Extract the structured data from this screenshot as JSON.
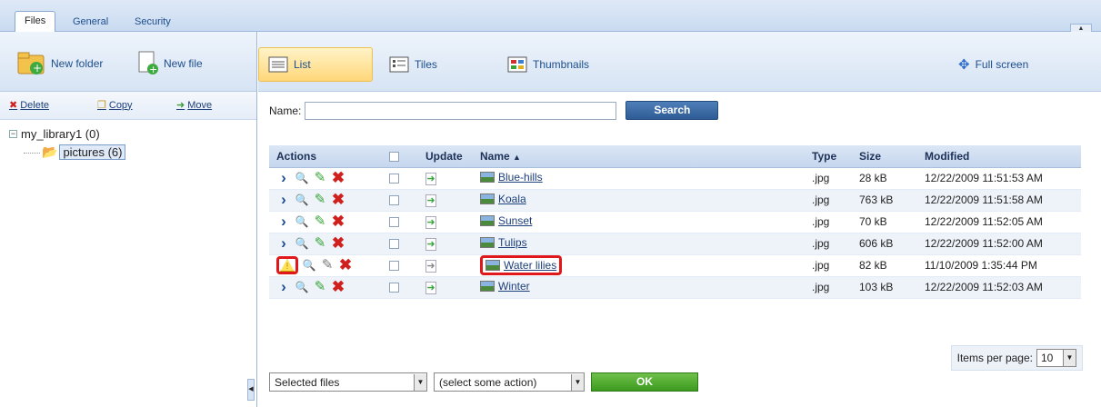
{
  "tabs": [
    "Files",
    "General",
    "Security"
  ],
  "left_toolbar": {
    "new_folder": "New folder",
    "new_file": "New file"
  },
  "left_actions": {
    "delete": "Delete",
    "copy": "Copy",
    "move": "Move"
  },
  "tree": {
    "root": "my_library1 (0)",
    "child": "pictures (6)"
  },
  "view_buttons": {
    "list": "List",
    "tiles": "Tiles",
    "thumbnails": "Thumbnails",
    "fullscreen": "Full screen"
  },
  "filter": {
    "label": "Name:",
    "value": "",
    "search": "Search"
  },
  "table": {
    "headers": {
      "actions": "Actions",
      "update": "Update",
      "name": "Name",
      "type": "Type",
      "size": "Size",
      "modified": "Modified"
    },
    "rows": [
      {
        "name": "Blue-hills",
        "type": ".jpg",
        "size": "28 kB",
        "modified": "12/22/2009 11:51:53 AM"
      },
      {
        "name": "Koala",
        "type": ".jpg",
        "size": "763 kB",
        "modified": "12/22/2009 11:51:58 AM"
      },
      {
        "name": "Sunset",
        "type": ".jpg",
        "size": "70 kB",
        "modified": "12/22/2009 11:52:05 AM"
      },
      {
        "name": "Tulips",
        "type": ".jpg",
        "size": "606 kB",
        "modified": "12/22/2009 11:52:00 AM"
      },
      {
        "name": "Water lilies",
        "type": ".jpg",
        "size": "82 kB",
        "modified": "11/10/2009 1:35:44 PM"
      },
      {
        "name": "Winter",
        "type": ".jpg",
        "size": "103 kB",
        "modified": "12/22/2009 11:52:03 AM"
      }
    ]
  },
  "pager": {
    "label": "Items per page:",
    "value": "10"
  },
  "bulk": {
    "selection": "Selected files",
    "action": "(select some action)",
    "ok": "OK"
  }
}
